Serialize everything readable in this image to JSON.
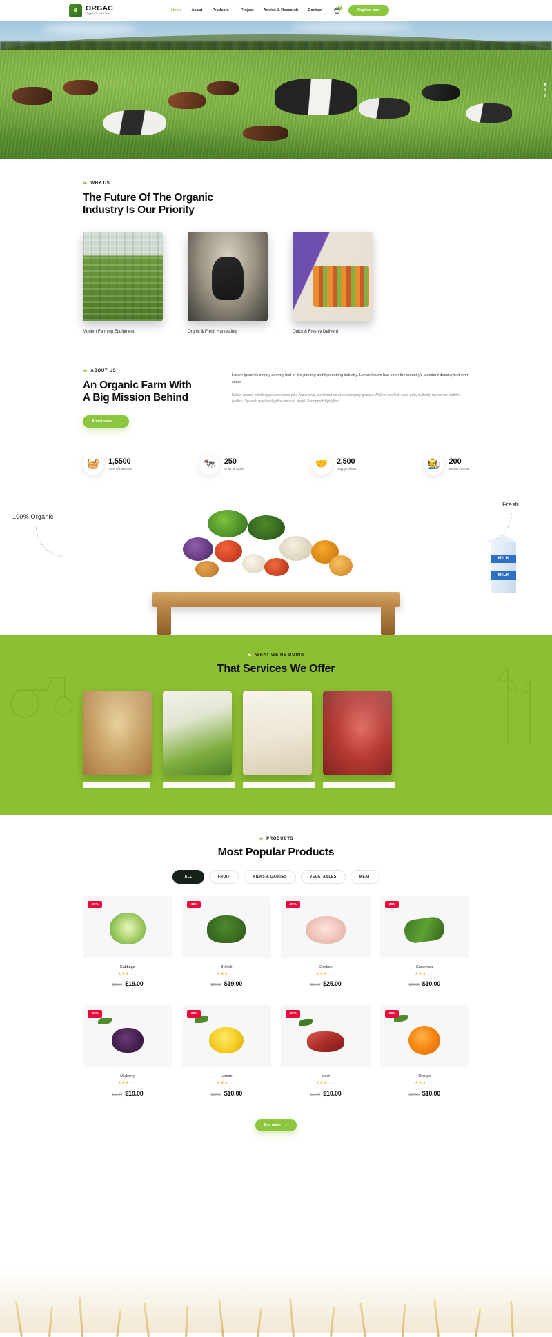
{
  "header": {
    "brand": {
      "name": "ORGAC",
      "tagline": "Organic & cattle farm",
      "logo_icon": "leaf-plant-icon"
    },
    "nav": [
      {
        "label": "Home",
        "active": true
      },
      {
        "label": "About",
        "active": false
      },
      {
        "label": "Products",
        "active": false,
        "has_dropdown": true
      },
      {
        "label": "Project",
        "active": false
      },
      {
        "label": "Advice & Research",
        "active": false
      },
      {
        "label": "Contact",
        "active": false
      }
    ],
    "cart": {
      "icon": "shopping-bag-icon",
      "badge": "2"
    },
    "register_label": "Register now",
    "accent_color": "#8cc63f"
  },
  "hero": {
    "alt": "Herd of cows grazing on a green pasture",
    "slide_dots": 3,
    "active_dot": 0
  },
  "why_us": {
    "eyebrow": "WHY US",
    "title": "The Future Of The Organic\nIndustry Is Our Priority",
    "title_line1": "The Future Of The Organic",
    "title_line2": "Industry Is Our Priority",
    "cards": [
      {
        "caption": "Modern Farming Equipment",
        "image": "greenhouse-crops"
      },
      {
        "caption": "Orgnic & Fresh Harvesting",
        "image": "farmer-harvesting-basket"
      },
      {
        "caption": "Quick & Freshly Deliverd",
        "image": "delivery-crate-of-produce"
      }
    ]
  },
  "about": {
    "eyebrow": "ABOUT US",
    "title_line1": "An Organic Farm With",
    "title_line2": "A Big Mission Behind",
    "lead": "Lorem Ipsum is simply dummy text of the printing and typesetting industry. Lorem Ipsum has been the industry's standard dummy text ever since.",
    "body": "Ballan wrasse climbing gourami amur pike Arctic char, steelhead sprat sea lamprey grunion Walleye poolfish sand goby butterfly ray stream catfish jewfish, Spanish mackerel yellow weaver sixgill. Sandperch flyingfish.",
    "button_label": "About more",
    "button_icon": "arrow-right-icon"
  },
  "stats": [
    {
      "icon": "produce-crate-icon",
      "value": "1,5500",
      "label": "Tons of harvesta"
    },
    {
      "icon": "cow-icon",
      "value": "250",
      "label": "Units of Cattle"
    },
    {
      "icon": "handshake-icon",
      "value": "2,500",
      "label": "Happy Clients"
    },
    {
      "icon": "farmer-icon",
      "value": "200",
      "label": "Expert Farmar"
    }
  ],
  "produce_showcase": {
    "label_left": "100% Organic",
    "label_right": "Fresh",
    "milk_text_top": "MILK",
    "milk_text_bottom": "MILK"
  },
  "services": {
    "eyebrow": "WHAT WE'RE DOING",
    "title": "That Services We Offer",
    "background_color": "#8dbf33",
    "cards": [
      {
        "image": "hands-holding-grain"
      },
      {
        "image": "fresh-vegetables-flatlay"
      },
      {
        "image": "milk-and-dairy-products"
      },
      {
        "image": "raw-meat-cuts"
      }
    ]
  },
  "products": {
    "eyebrow": "PRODUCTS",
    "title": "Most Popular Products",
    "filters": [
      {
        "label": "ALL",
        "active": true
      },
      {
        "label": "FRUIT",
        "active": false
      },
      {
        "label": "MILKS & DAIRIES",
        "active": false
      },
      {
        "label": "VEGETABLES",
        "active": false
      },
      {
        "label": "MEAT",
        "active": false
      }
    ],
    "items": [
      {
        "name": "Cabbage",
        "badge": "-20%",
        "rating": 3,
        "old_price": "$22.00",
        "price": "$19.00",
        "art": "a-cabbage"
      },
      {
        "name": "Brokoli",
        "badge": "-10%",
        "rating": 3,
        "old_price": "$22.00",
        "price": "$19.00",
        "art": "a-broccoli"
      },
      {
        "name": "Chicken",
        "badge": "-20%",
        "rating": 3,
        "old_price": "$35.00",
        "price": "$25.00",
        "art": "a-chicken"
      },
      {
        "name": "Cucumber",
        "badge": "-20%",
        "rating": 3,
        "old_price": "$32.00",
        "price": "$10.00",
        "art": "a-cucumber"
      },
      {
        "name": "Mulberry",
        "badge": "-20%",
        "rating": 3,
        "old_price": "$32.00",
        "price": "$10.00",
        "art": "a-mulberry"
      },
      {
        "name": "Lemon",
        "badge": "-20%",
        "rating": 3,
        "old_price": "$32.00",
        "price": "$10.00",
        "art": "a-lemon"
      },
      {
        "name": "Meat",
        "badge": "-20%",
        "rating": 3,
        "old_price": "$32.00",
        "price": "$10.00",
        "art": "a-meat"
      },
      {
        "name": "Orange",
        "badge": "-20%",
        "rating": 3,
        "old_price": "$32.00",
        "price": "$10.00",
        "art": "a-orange"
      }
    ],
    "see_more_label": "See more",
    "see_more_icon": "arrow-right-icon",
    "badge_color": "#ea0b3c",
    "star_color": "#f5a623"
  }
}
